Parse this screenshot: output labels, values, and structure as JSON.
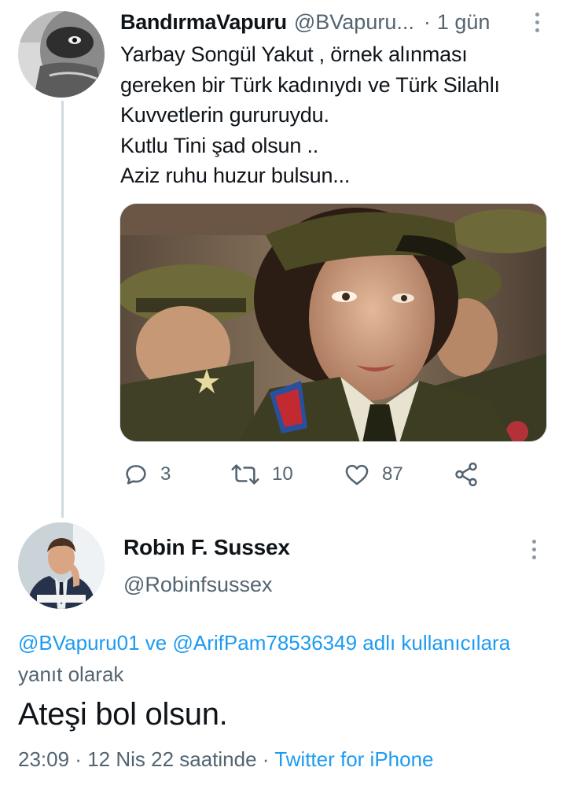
{
  "tweet1": {
    "name": "BandırmaVapuru",
    "handle": "@BVapuru...",
    "separator": "·",
    "time": "1 gün",
    "lines": [
      "Yarbay Songül Yakut , örnek alınması",
      "gereken bir Türk kadınıydı ve  Türk Silahlı",
      "Kuvvetlerin gururuydu.",
      "Kutlu Tini şad olsun ..",
      "Aziz ruhu huzur bulsun..."
    ],
    "actions": {
      "replies": "3",
      "retweets": "10",
      "likes": "87"
    }
  },
  "tweet2": {
    "name": "Robin F. Sussex",
    "handle": "@Robinfsussex",
    "reply": {
      "user1": "@BVapuru01",
      "and": " ve ",
      "user2": "@ArifPam78536349",
      "suffix_link": " adlı kullanıcılara",
      "suffix_text": " yanıt olarak"
    },
    "text": "Ateşi bol olsun.",
    "meta": {
      "time": "23:09",
      "sep1": " · ",
      "date": "12 Nis 22 saatinde",
      "sep2": " · ",
      "source": "Twitter for iPhone"
    }
  },
  "icons": [
    "reply-icon",
    "retweet-icon",
    "like-icon",
    "share-icon",
    "more-icon"
  ],
  "colors": {
    "link": "#1d9bf0",
    "secondary": "#536471",
    "text": "#0f1419",
    "thread_line": "#cfd9de"
  }
}
